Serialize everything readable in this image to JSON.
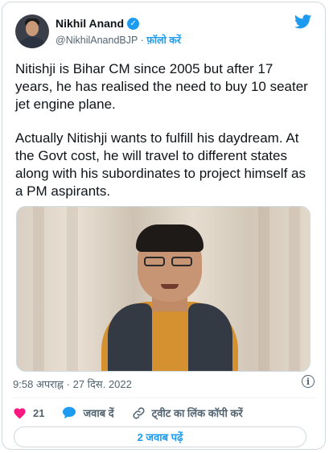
{
  "tweet": {
    "author": {
      "name": "Nikhil Anand",
      "handle": "@NikhilAnandBJP",
      "separator": "·",
      "follow_label": "फ़ॉलो करें",
      "verified": true
    },
    "text": {
      "para1": "Nitishji is Bihar CM since 2005 but after 17 years, he has realised the need to buy 10 seater jet engine plane.",
      "para2": "Actually Nitishji wants to fulfill his daydream. At the Govt cost, he will travel to different states along with his subordinates to project himself as a PM aspirants."
    },
    "meta": {
      "time": "9:58 अपराह्न",
      "separator": "·",
      "date": "27 दिस. 2022"
    },
    "actions": {
      "like_count": "21",
      "reply_label": "जवाब दें",
      "copy_link_label": "ट्वीट का लिंक कॉपी करें"
    },
    "replies_button_label": "2 जवाब पढ़ें"
  },
  "icons": {
    "brand": "twitter-bird-icon",
    "verified": "verified-badge-icon",
    "info": "info-icon",
    "like": "heart-icon",
    "reply": "speech-bubble-icon",
    "link": "link-icon"
  },
  "colors": {
    "accent": "#1d9bf0",
    "like": "#f91880",
    "text": "#0f1419",
    "secondary": "#536471",
    "border": "#cfd9de"
  }
}
